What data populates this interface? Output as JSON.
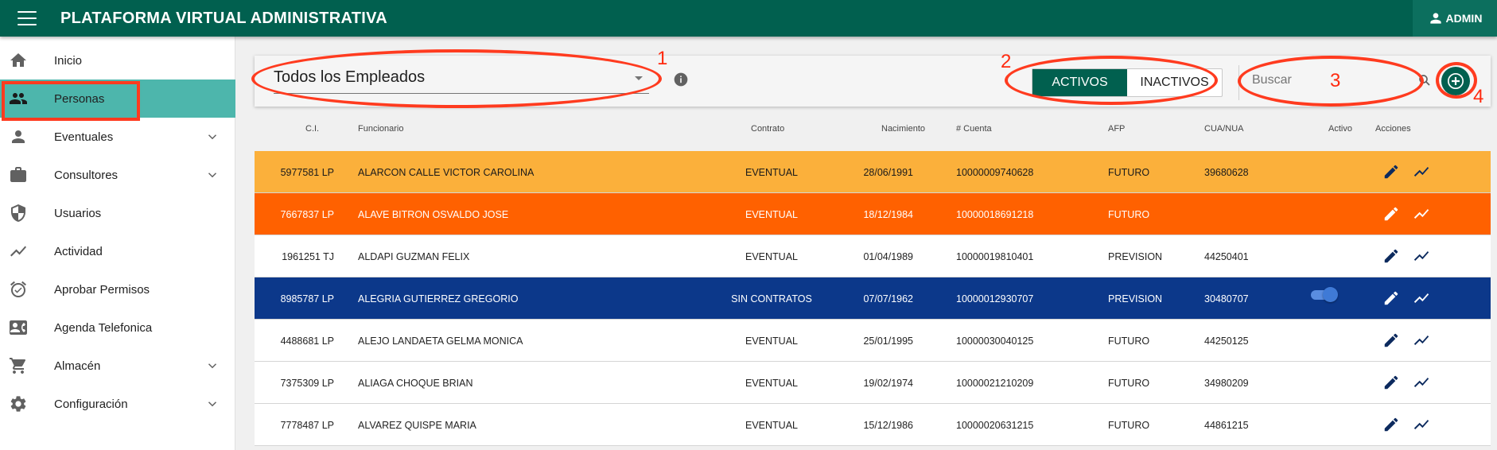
{
  "header": {
    "title": "PLATAFORMA VIRTUAL ADMINISTRATIVA",
    "user_label": "ADMIN"
  },
  "sidebar": {
    "items": [
      {
        "label": "Inicio",
        "icon": "home-icon",
        "expandable": false,
        "active": false
      },
      {
        "label": "Personas",
        "icon": "people-icon",
        "expandable": false,
        "active": true
      },
      {
        "label": "Eventuales",
        "icon": "person-icon",
        "expandable": true,
        "active": false
      },
      {
        "label": "Consultores",
        "icon": "briefcase-icon",
        "expandable": true,
        "active": false
      },
      {
        "label": "Usuarios",
        "icon": "shield-icon",
        "expandable": false,
        "active": false
      },
      {
        "label": "Actividad",
        "icon": "trending-icon",
        "expandable": false,
        "active": false
      },
      {
        "label": "Aprobar Permisos",
        "icon": "alarm-icon",
        "expandable": false,
        "active": false
      },
      {
        "label": "Agenda Telefonica",
        "icon": "contact-card-icon",
        "expandable": false,
        "active": false
      },
      {
        "label": "Almacén",
        "icon": "cart-icon",
        "expandable": true,
        "active": false
      },
      {
        "label": "Configuración",
        "icon": "gear-icon",
        "expandable": true,
        "active": false
      }
    ]
  },
  "toolbar": {
    "filter_value": "Todos los Empleados",
    "toggle": {
      "active_label": "ACTIVOS",
      "inactive_label": "INACTIVOS",
      "selected": "ACTIVOS"
    },
    "search_placeholder": "Buscar"
  },
  "table": {
    "headers": {
      "ci": "C.I.",
      "funcionario": "Funcionario",
      "contrato": "Contrato",
      "nacimiento": "Nacimiento",
      "cuenta": "# Cuenta",
      "afp": "AFP",
      "cua": "CUA/NUA",
      "activo": "Activo",
      "acciones": "Acciones"
    },
    "rows": [
      {
        "ci": "5977581 LP",
        "funcionario": "ALARCON CALLE VICTOR CAROLINA",
        "contrato": "EVENTUAL",
        "nacimiento": "28/06/1991",
        "cuenta": "10000009740628",
        "afp": "FUTURO",
        "cua": "39680628",
        "color": "#fbb03b",
        "activo_switch": false
      },
      {
        "ci": "7667837 LP",
        "funcionario": "ALAVE BITRON OSVALDO JOSE",
        "contrato": "EVENTUAL",
        "nacimiento": "18/12/1984",
        "cuenta": "10000018691218",
        "afp": "FUTURO",
        "cua": "",
        "color": "#ff6100",
        "activo_switch": false
      },
      {
        "ci": "1961251 TJ",
        "funcionario": "ALDAPI GUZMAN FELIX",
        "contrato": "EVENTUAL",
        "nacimiento": "01/04/1989",
        "cuenta": "10000019810401",
        "afp": "PREVISION",
        "cua": "44250401",
        "color": "#ffffff",
        "activo_switch": false
      },
      {
        "ci": "8985787 LP",
        "funcionario": "ALEGRIA GUTIERREZ GREGORIO",
        "contrato": "SIN CONTRATOS",
        "nacimiento": "07/07/1962",
        "cuenta": "10000012930707",
        "afp": "PREVISION",
        "cua": "30480707",
        "color": "#0c388a",
        "activo_switch": true
      },
      {
        "ci": "4488681 LP",
        "funcionario": "ALEJO LANDAETA GELMA MONICA",
        "contrato": "EVENTUAL",
        "nacimiento": "25/01/1995",
        "cuenta": "10000030040125",
        "afp": "FUTURO",
        "cua": "44250125",
        "color": "#ffffff",
        "activo_switch": false
      },
      {
        "ci": "7375309 LP",
        "funcionario": "ALIAGA CHOQUE BRIAN",
        "contrato": "EVENTUAL",
        "nacimiento": "19/02/1974",
        "cuenta": "10000021210209",
        "afp": "FUTURO",
        "cua": "34980209",
        "color": "#ffffff",
        "activo_switch": false
      },
      {
        "ci": "7778487 LP",
        "funcionario": "ALVAREZ QUISPE MARIA",
        "contrato": "EVENTUAL",
        "nacimiento": "15/12/1986",
        "cuenta": "10000020631215",
        "afp": "FUTURO",
        "cua": "44861215",
        "color": "#ffffff",
        "activo_switch": false
      }
    ]
  },
  "annotations": {
    "n1": "1",
    "n2": "2",
    "n3": "3",
    "n4": "4"
  },
  "colors": {
    "header": "#01604f",
    "sidebar_active": "#4db6ac",
    "annotation": "#ff3b1f",
    "action_icon": "#0c2a5e"
  }
}
